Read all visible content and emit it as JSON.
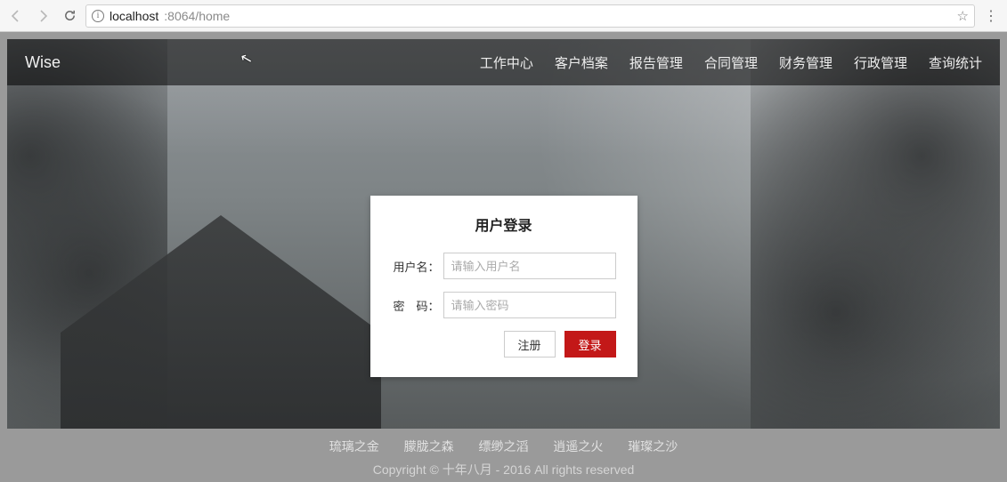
{
  "browser": {
    "url_host": "localhost",
    "url_port_path": ":8064/home"
  },
  "brand": "Wise",
  "nav": {
    "items": [
      {
        "label": "工作中心"
      },
      {
        "label": "客户档案"
      },
      {
        "label": "报告管理"
      },
      {
        "label": "合同管理"
      },
      {
        "label": "财务管理"
      },
      {
        "label": "行政管理"
      },
      {
        "label": "查询统计"
      }
    ]
  },
  "login": {
    "title": "用户登录",
    "username_label": "用户名：",
    "username_placeholder": "请输入用户名",
    "username_value": "",
    "password_label": "密　码：",
    "password_placeholder": "请输入密码",
    "password_value": "",
    "register_label": "注册",
    "submit_label": "登录"
  },
  "footer": {
    "links": [
      {
        "label": "琉璃之金"
      },
      {
        "label": "朦胧之森"
      },
      {
        "label": "缥缈之滔"
      },
      {
        "label": "逍遥之火"
      },
      {
        "label": "璀璨之沙"
      }
    ],
    "copyright": "Copyright © 十年八月 - 2016 All rights reserved"
  }
}
